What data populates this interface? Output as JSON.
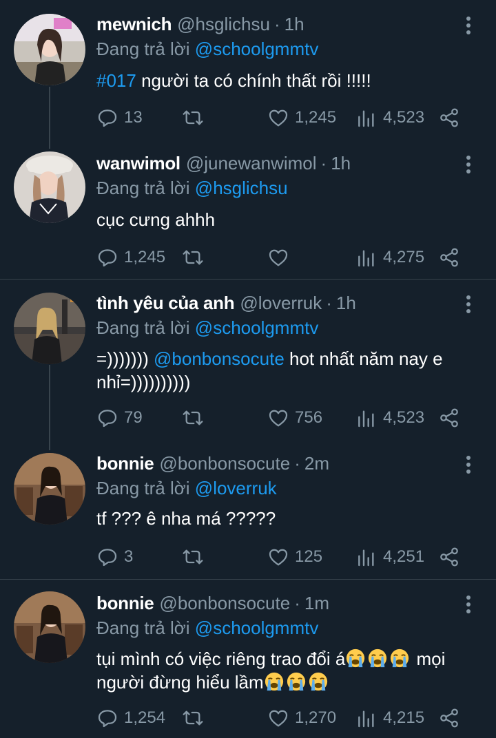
{
  "reply_prefix": "Đang trả lời",
  "tweets": [
    {
      "name": "mewnich",
      "handle": "@hsglichsu",
      "sep": "·",
      "time": "1h",
      "reply_to": "@schoolgmmtv",
      "text_link": "#017",
      "text": " người ta có chính thất rồi !!!!!",
      "replies": "13",
      "likes": "1,245",
      "views": "4,523"
    },
    {
      "name": "wanwimol",
      "handle": "@junewanwimol",
      "sep": "·",
      "time": "1h",
      "reply_to": "@hsglichsu",
      "text": "cục cưng ahhh",
      "replies": "1,245",
      "likes": "",
      "views": "4,275"
    },
    {
      "name": "tình yêu của anh",
      "handle": "@loverruk",
      "sep": "·",
      "time": "1h",
      "reply_to": "@schoolgmmtv",
      "text_pre": "=))))))) ",
      "text_link": "@bonbonsocute",
      "text": " hot nhất năm nay e nhỉ=))))))))))",
      "replies": "79",
      "likes": "756",
      "views": "4,523"
    },
    {
      "name": "bonnie",
      "handle": "@bonbonsocute",
      "sep": "·",
      "time": "2m",
      "reply_to": "@loverruk",
      "text": "tf ??? ê nha má ?????",
      "replies": "3",
      "likes": "125",
      "views": "4,251"
    },
    {
      "name": "bonnie",
      "handle": "@bonbonsocute",
      "sep": "·",
      "time": "1m",
      "reply_to": "@schoolgmmtv",
      "text": "tụi mình có việc riêng trao đổi á",
      "text_after": " mọi người đừng hiểu lầm",
      "replies": "1,254",
      "likes": "1,270",
      "views": "4,215"
    }
  ],
  "colors": {
    "background": "#15202b",
    "secondary_text": "#8899a6",
    "link": "#1d9bf0",
    "divider": "#38444d"
  },
  "icons": [
    "reply-icon",
    "retweet-icon",
    "like-icon",
    "views-icon",
    "share-icon",
    "more-icon",
    "loudly-crying-face-emoji"
  ]
}
